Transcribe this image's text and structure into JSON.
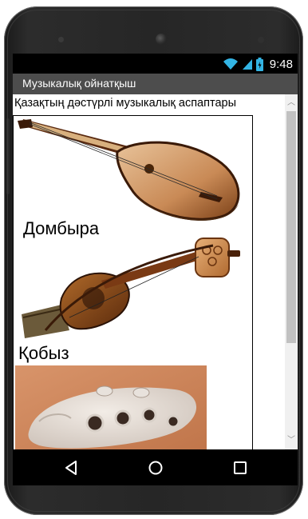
{
  "status": {
    "time": "9:48",
    "icons": [
      "wifi-icon",
      "signal-icon",
      "battery-icon"
    ]
  },
  "app": {
    "title": "Музыкалық ойнатқыш"
  },
  "main": {
    "heading": "Қазақтың дәстүрлі музыкалық аспаптары",
    "instruments": [
      {
        "name": "Домбыра",
        "image": "dombra-image"
      },
      {
        "name": "Қобыз",
        "image": "kobyz-image"
      },
      {
        "name": "",
        "image": "sazsyrnai-image"
      }
    ]
  },
  "nav": {
    "items": [
      "back-icon",
      "home-icon",
      "recents-icon"
    ]
  },
  "colors": {
    "titlebar": "#4d4d4d",
    "statusbar": "#000000",
    "accent": "#33b5e5",
    "wood": "#8b4a1c"
  }
}
